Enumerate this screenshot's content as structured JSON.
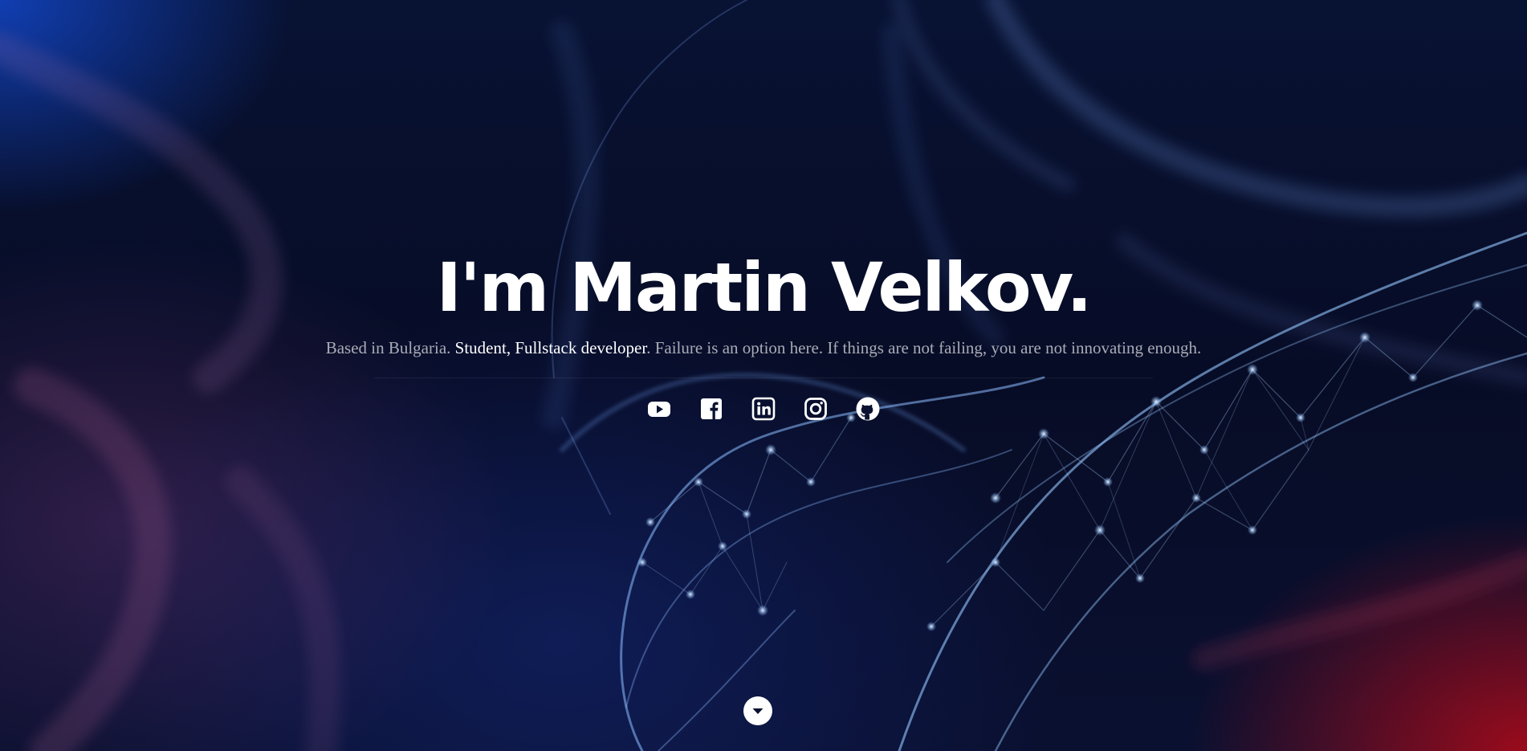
{
  "hero": {
    "headline": "I'm Martin Velkov.",
    "intro": {
      "lead": "Based in Bulgaria.",
      "highlight": "Student, Fullstack developer",
      "tail": ". Failure is an option here. If things are not failing, you are not innovating enough."
    }
  },
  "social": [
    {
      "icon": "youtube-icon"
    },
    {
      "icon": "facebook-icon"
    },
    {
      "icon": "linkedin-icon"
    },
    {
      "icon": "instagram-icon"
    },
    {
      "icon": "github-icon"
    }
  ],
  "scroll": {
    "icon": "chevron-down-icon"
  },
  "colors": {
    "headline": "#ffffff",
    "intro_text": "#a9acb6",
    "intro_highlight": "#ffffff",
    "background_dark": "#070c26",
    "glow_blue": "#1246c8",
    "glow_red": "#aa0a19",
    "network_lines": "#8fc4ff"
  }
}
